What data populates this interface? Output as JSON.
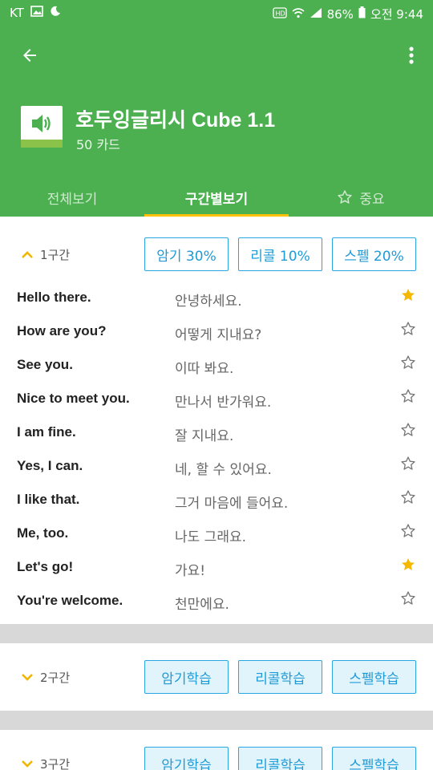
{
  "status_bar": {
    "carrier": "KT",
    "battery": "86%",
    "time": "오전 9:44",
    "icons": [
      "image-icon",
      "moon-icon",
      "hd-icon",
      "wifi-icon",
      "signal-icon",
      "battery-icon"
    ]
  },
  "app_bar": {
    "back_icon": "arrow-back-icon",
    "more_icon": "more-vertical-icon"
  },
  "deck": {
    "title": "호두잉글리시 Cube 1.1",
    "subtitle": "50 카드",
    "icon": "speaker-icon"
  },
  "tabs": [
    {
      "label": "전체보기",
      "active": false
    },
    {
      "label": "구간별보기",
      "active": true
    },
    {
      "label": "중요",
      "active": false,
      "icon": "star-outline-icon"
    }
  ],
  "sections": [
    {
      "label": "1구간",
      "expanded": true,
      "buttons": [
        "암기 30%",
        "리콜 10%",
        "스펠 20%"
      ],
      "items": [
        {
          "en": "Hello there.",
          "ko": "안녕하세요.",
          "starred": true
        },
        {
          "en": "How are you?",
          "ko": "어떻게 지내요?",
          "starred": false
        },
        {
          "en": "See you.",
          "ko": "이따 봐요.",
          "starred": false
        },
        {
          "en": "Nice to meet you.",
          "ko": "만나서 반가워요.",
          "starred": false
        },
        {
          "en": "I am fine.",
          "ko": "잘 지내요.",
          "starred": false
        },
        {
          "en": "Yes, I can.",
          "ko": "네, 할 수 있어요.",
          "starred": false
        },
        {
          "en": "I like that.",
          "ko": "그거 마음에 들어요.",
          "starred": false
        },
        {
          "en": "Me, too.",
          "ko": "나도 그래요.",
          "starred": false
        },
        {
          "en": "Let's go!",
          "ko": "가요!",
          "starred": true
        },
        {
          "en": "You're welcome.",
          "ko": "천만에요.",
          "starred": false
        }
      ]
    },
    {
      "label": "2구간",
      "expanded": false,
      "buttons": [
        "암기학습",
        "리콜학습",
        "스펠학습"
      ]
    },
    {
      "label": "3구간",
      "expanded": false,
      "buttons": [
        "암기학습",
        "리콜학습",
        "스펠학습"
      ]
    }
  ],
  "colors": {
    "primary": "#4cb050",
    "accent": "#ffc107",
    "button_blue": "#1e9bd7",
    "star_filled": "#f5b800"
  }
}
